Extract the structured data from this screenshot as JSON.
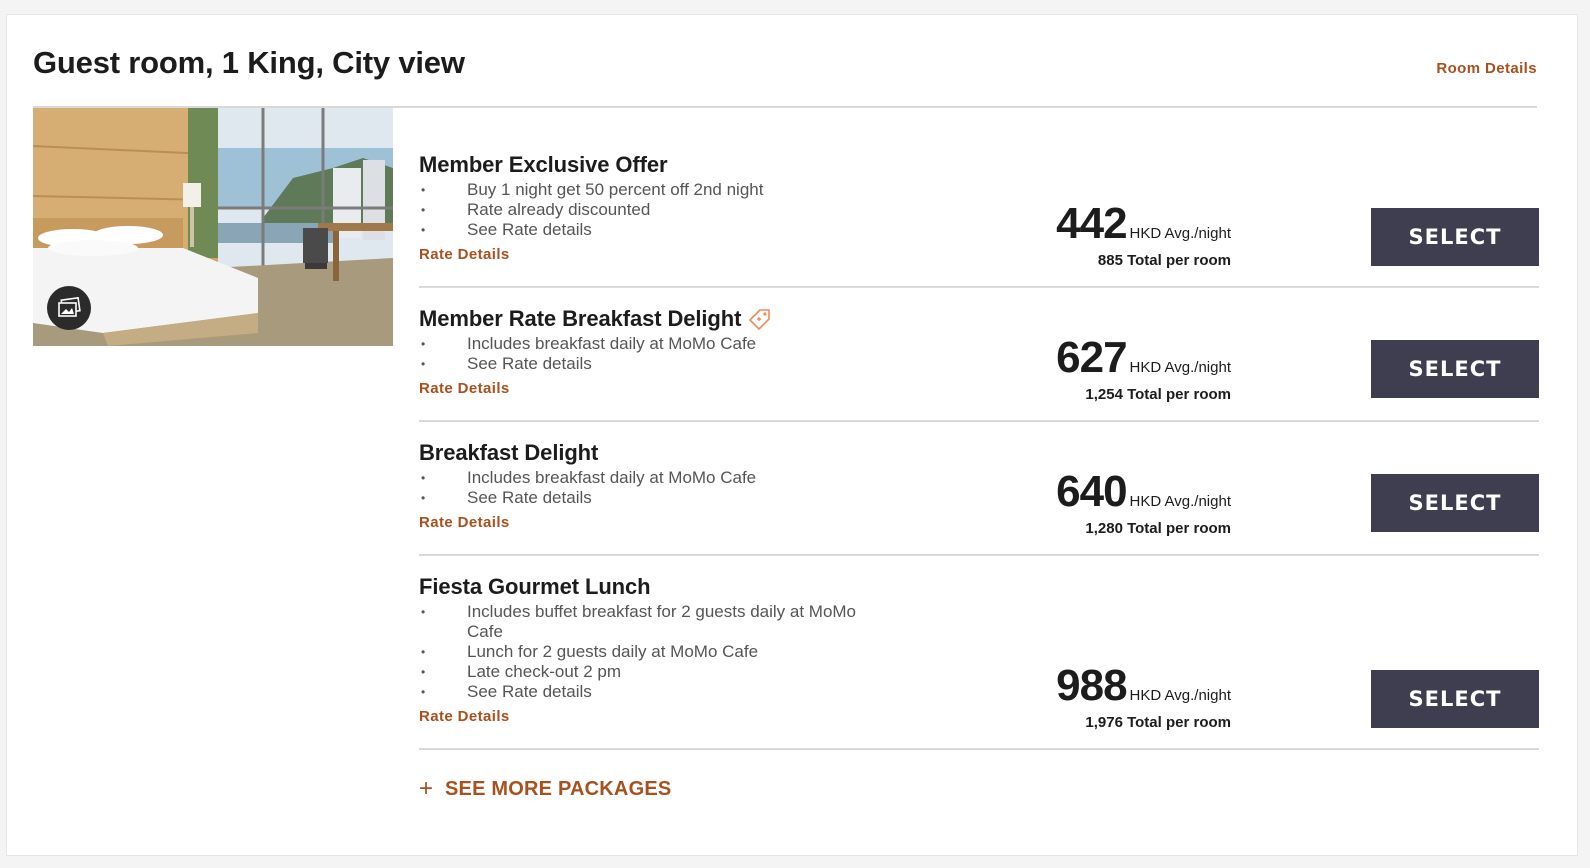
{
  "room": {
    "title": "Guest room, 1 King, City view",
    "details_link": "Room Details"
  },
  "rates": [
    {
      "name": "Member Exclusive Offer",
      "has_tag_icon": false,
      "bullets": [
        "Buy 1 night get 50 percent off 2nd night",
        "Rate already discounted",
        "See Rate details"
      ],
      "details_link": "Rate Details",
      "price": "442",
      "price_unit": "HKD Avg./night",
      "total": "885",
      "total_label": "Total per room",
      "select_label": "SELECT"
    },
    {
      "name": "Member Rate Breakfast Delight",
      "has_tag_icon": true,
      "bullets": [
        "Includes breakfast daily at MoMo Cafe",
        "See Rate details"
      ],
      "details_link": "Rate Details",
      "price": "627",
      "price_unit": "HKD Avg./night",
      "total": "1,254",
      "total_label": "Total per room",
      "select_label": "SELECT"
    },
    {
      "name": "Breakfast Delight",
      "has_tag_icon": false,
      "bullets": [
        "Includes breakfast daily at MoMo Cafe",
        "See Rate details"
      ],
      "details_link": "Rate Details",
      "price": "640",
      "price_unit": "HKD Avg./night",
      "total": "1,280",
      "total_label": "Total per room",
      "select_label": "SELECT"
    },
    {
      "name": "Fiesta Gourmet Lunch",
      "has_tag_icon": false,
      "bullets": [
        "Includes buffet breakfast for 2 guests daily at MoMo Cafe",
        "Lunch for 2 guests daily at MoMo Cafe",
        "Late check-out 2 pm",
        "See Rate details"
      ],
      "details_link": "Rate Details",
      "price": "988",
      "price_unit": "HKD Avg./night",
      "total": "1,976",
      "total_label": "Total per room",
      "select_label": "SELECT"
    }
  ],
  "see_more": {
    "plus": "+",
    "label": "SEE MORE PACKAGES"
  },
  "colors": {
    "accent": "#a8501e",
    "button_bg": "#3f3d50",
    "tag_icon": "#f08a5d"
  },
  "icons": {
    "gallery": "gallery-icon",
    "tag": "price-tag-icon"
  }
}
